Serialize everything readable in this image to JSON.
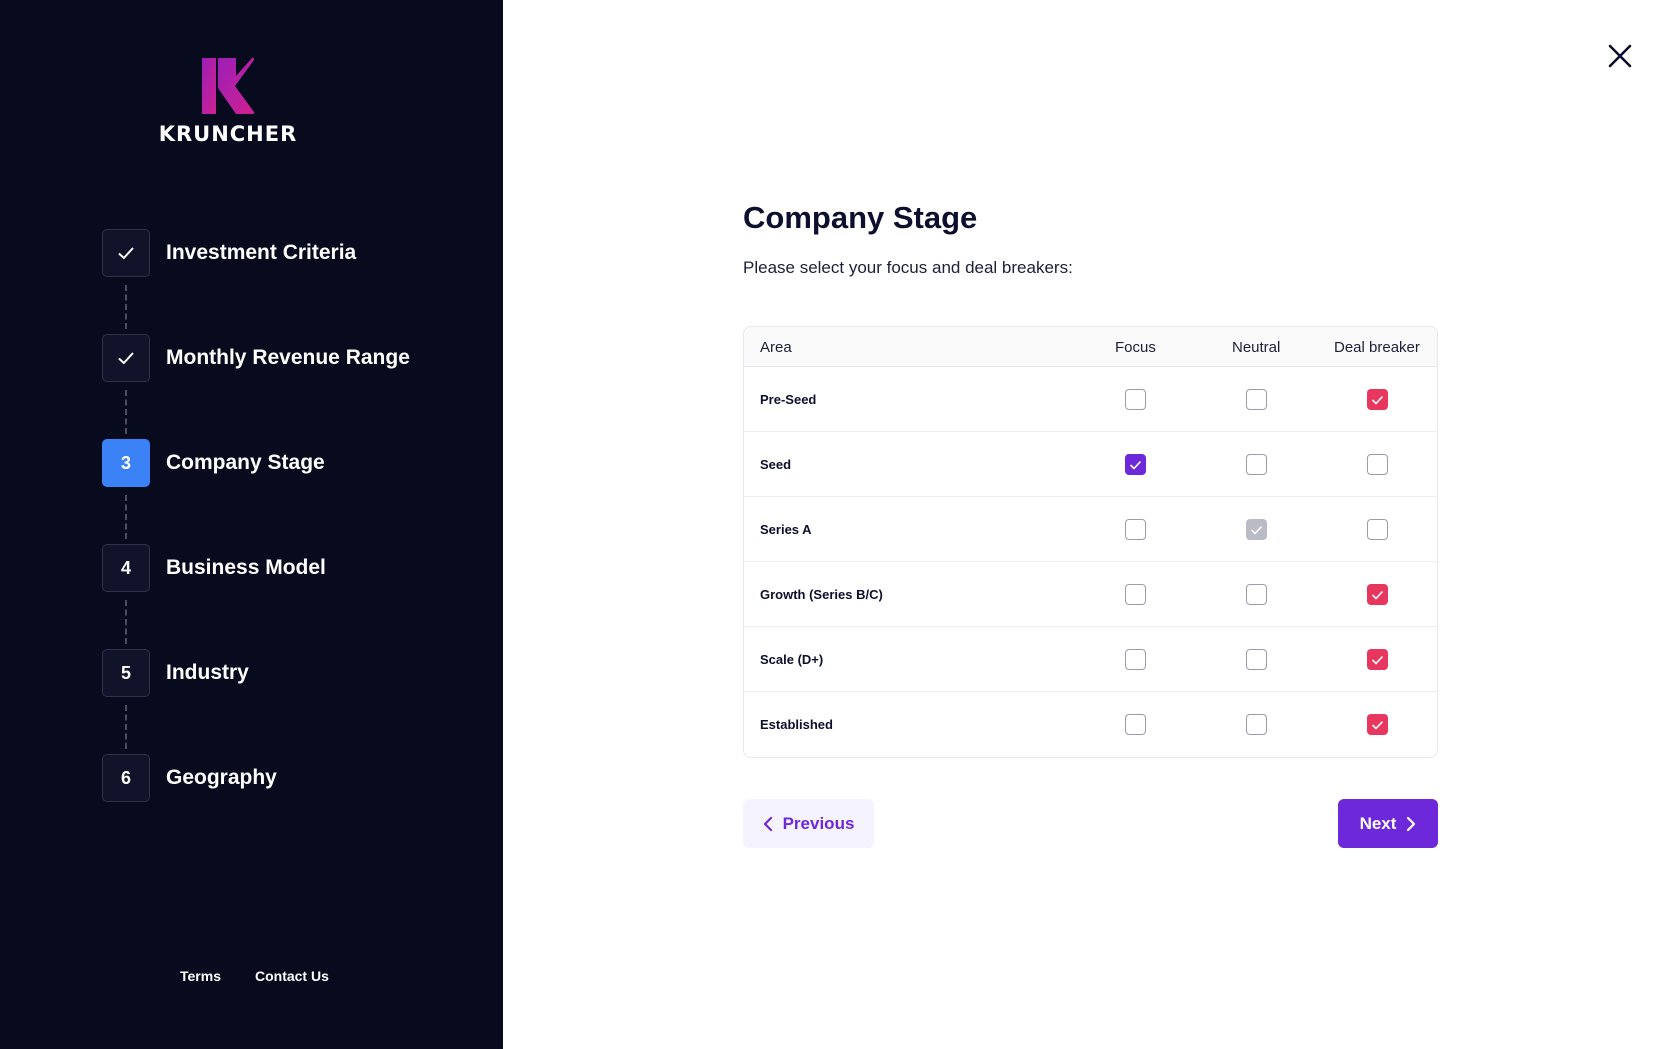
{
  "brand": {
    "name": "KRUNCHER",
    "logo_icon": "k-logo-icon"
  },
  "steps": [
    {
      "number": "1",
      "label": "Investment Criteria",
      "state": "completed"
    },
    {
      "number": "2",
      "label": "Monthly Revenue Range",
      "state": "completed"
    },
    {
      "number": "3",
      "label": "Company Stage",
      "state": "active"
    },
    {
      "number": "4",
      "label": "Business Model",
      "state": "pending"
    },
    {
      "number": "5",
      "label": "Industry",
      "state": "pending"
    },
    {
      "number": "6",
      "label": "Geography",
      "state": "pending"
    }
  ],
  "footer": {
    "terms": "Terms",
    "contact": "Contact Us"
  },
  "main": {
    "title": "Company Stage",
    "subtitle": "Please select your focus and deal breakers:"
  },
  "table": {
    "columns": [
      "Area",
      "Focus",
      "Neutral",
      "Deal breaker"
    ],
    "rows": [
      {
        "area": "Pre-Seed",
        "selected": "Deal breaker"
      },
      {
        "area": "Seed",
        "selected": "Focus"
      },
      {
        "area": "Series A",
        "selected": "Neutral"
      },
      {
        "area": "Growth (Series B/C)",
        "selected": "Deal breaker"
      },
      {
        "area": "Scale (D+)",
        "selected": "Deal breaker"
      },
      {
        "area": "Established",
        "selected": "Deal breaker"
      }
    ]
  },
  "buttons": {
    "previous": "Previous",
    "next": "Next"
  },
  "colors": {
    "sidebar_bg": "#080a1e",
    "active_step": "#3b82f6",
    "focus_checked": "#6d28d9",
    "neutral_checked": "#b9bbc6",
    "deal_breaker_checked": "#e8375e",
    "primary_button": "#6d28d9"
  }
}
